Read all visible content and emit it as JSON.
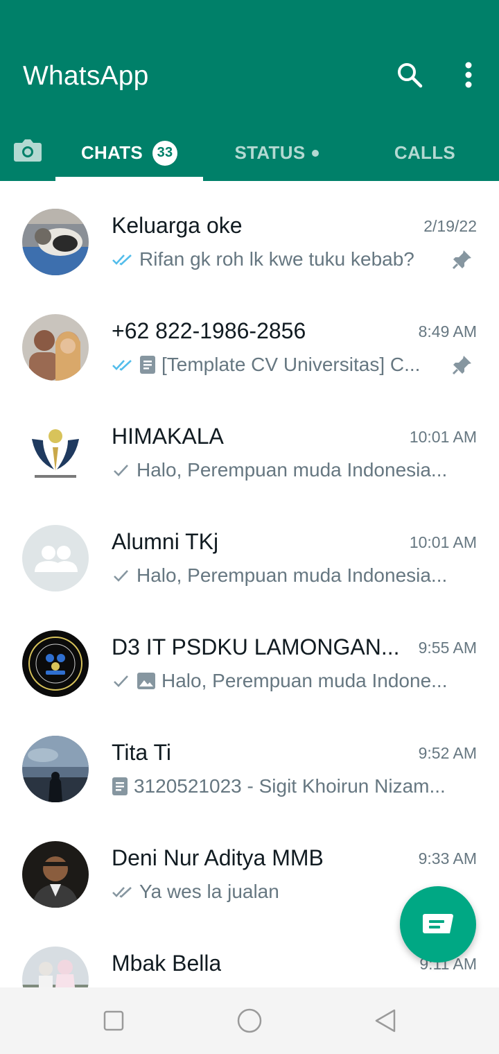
{
  "app": {
    "title": "WhatsApp"
  },
  "tabs": {
    "chats_label": "CHATS",
    "chats_badge": "33",
    "status_label": "STATUS",
    "calls_label": "CALLS"
  },
  "colors": {
    "header": "#008069",
    "accent": "#00a884",
    "read_tick": "#53bdeb"
  },
  "chats": [
    {
      "name": "Keluarga oke",
      "time": "2/19/22",
      "tick": "double-blue",
      "icon": "",
      "preview": "Rifan gk roh lk kwe tuku kebab?",
      "pinned": true
    },
    {
      "name": "+62 822-1986-2856",
      "time": "8:49 AM",
      "tick": "double-blue",
      "icon": "document-icon",
      "preview": "[Template CV Universitas] C...",
      "pinned": true
    },
    {
      "name": "HIMAKALA",
      "time": "10:01 AM",
      "tick": "single-grey",
      "icon": "",
      "preview": "Halo, Perempuan muda Indonesia...",
      "pinned": false
    },
    {
      "name": "Alumni TKj",
      "time": "10:01 AM",
      "tick": "single-grey",
      "icon": "",
      "preview": "Halo, Perempuan muda Indonesia...",
      "pinned": false
    },
    {
      "name": "D3 IT PSDKU LAMONGAN...",
      "time": "9:55 AM",
      "tick": "single-grey",
      "icon": "photo-icon",
      "preview": "Halo, Perempuan muda Indone...",
      "pinned": false
    },
    {
      "name": "Tita Ti",
      "time": "9:52 AM",
      "tick": "",
      "icon": "document-icon",
      "preview": "3120521023 - Sigit Khoirun Nizam...",
      "pinned": false
    },
    {
      "name": "Deni Nur Aditya MMB",
      "time": "9:33 AM",
      "tick": "double-grey",
      "icon": "",
      "preview": "Ya wes la jualan",
      "pinned": false
    },
    {
      "name": "Mbak Bella",
      "time": "9:11 AM",
      "tick": "",
      "icon": "",
      "preview": "",
      "pinned": false
    }
  ]
}
